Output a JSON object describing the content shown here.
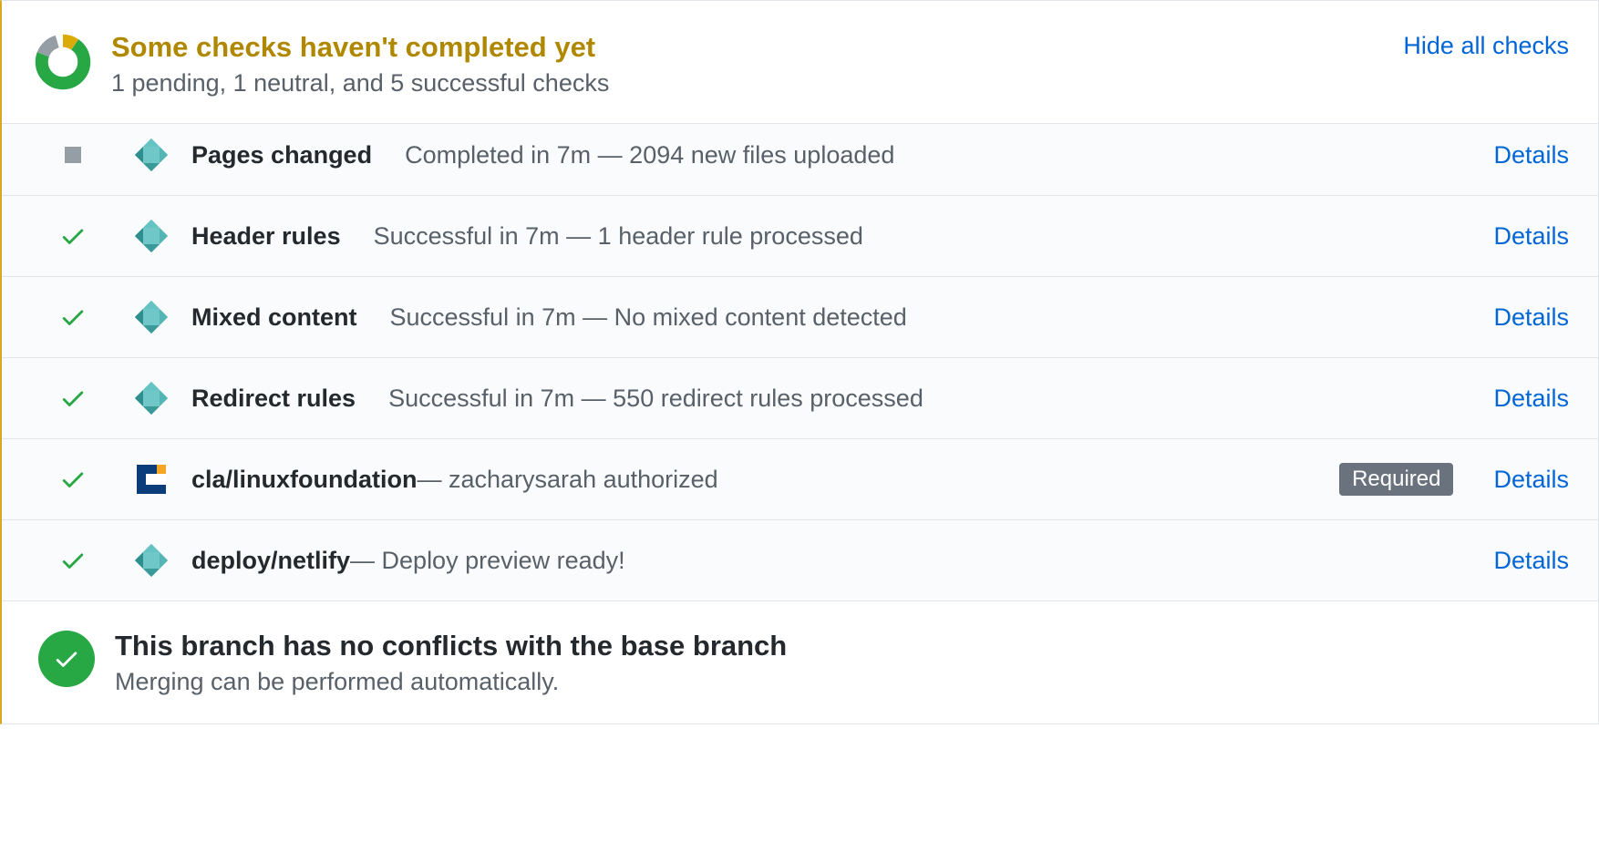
{
  "header": {
    "title": "Some checks haven't completed yet",
    "subtitle": "1 pending, 1 neutral, and 5 successful checks",
    "hide_label": "Hide all checks"
  },
  "checks": [
    {
      "status": "neutral",
      "icon": "netlify",
      "name": "Pages changed",
      "desc": "Completed in 7m — 2094 new files uploaded",
      "sep": "gap",
      "required": false,
      "details": "Details"
    },
    {
      "status": "success",
      "icon": "netlify",
      "name": "Header rules",
      "desc": "Successful in 7m — 1 header rule processed",
      "sep": "gap",
      "required": false,
      "details": "Details"
    },
    {
      "status": "success",
      "icon": "netlify",
      "name": "Mixed content",
      "desc": "Successful in 7m — No mixed content detected",
      "sep": "gap",
      "required": false,
      "details": "Details"
    },
    {
      "status": "success",
      "icon": "netlify",
      "name": "Redirect rules",
      "desc": "Successful in 7m — 550 redirect rules processed",
      "sep": "gap",
      "required": false,
      "details": "Details"
    },
    {
      "status": "success",
      "icon": "lf",
      "name": "cla/linuxfoundation",
      "desc": " — zacharysarah authorized",
      "sep": "none",
      "required": true,
      "details": "Details"
    },
    {
      "status": "success",
      "icon": "netlify",
      "name": "deploy/netlify",
      "desc": " — Deploy preview ready!",
      "sep": "none",
      "required": false,
      "details": "Details"
    }
  ],
  "required_badge": "Required",
  "merge": {
    "title": "This branch has no conflicts with the base branch",
    "subtitle": "Merging can be performed automatically."
  },
  "colors": {
    "pending": "#b08800",
    "success": "#28a745",
    "neutral_square": "#959da5",
    "link": "#0366d6"
  }
}
